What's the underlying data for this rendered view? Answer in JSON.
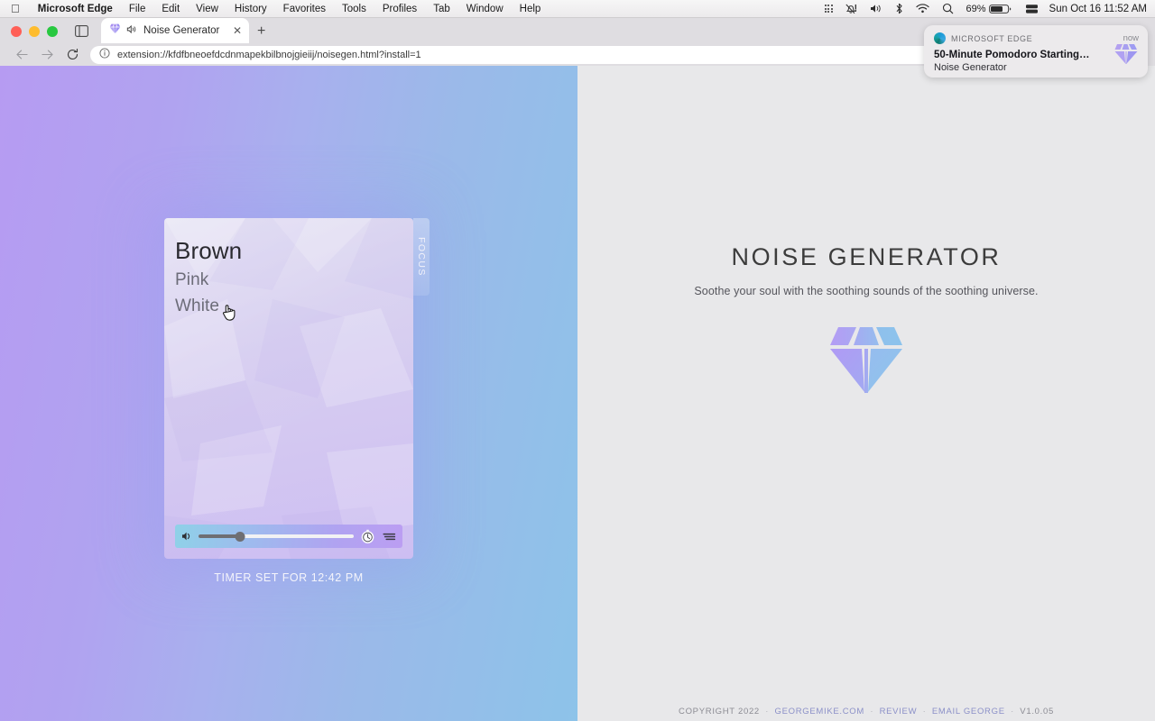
{
  "menubar": {
    "apple_icon": "apple-logo-icon",
    "items": [
      {
        "label": "Microsoft Edge",
        "bold": true
      },
      {
        "label": "File",
        "bold": false
      },
      {
        "label": "Edit",
        "bold": false
      },
      {
        "label": "View",
        "bold": false
      },
      {
        "label": "History",
        "bold": false
      },
      {
        "label": "Favorites",
        "bold": false
      },
      {
        "label": "Tools",
        "bold": false
      },
      {
        "label": "Profiles",
        "bold": false
      },
      {
        "label": "Tab",
        "bold": false
      },
      {
        "label": "Window",
        "bold": false
      },
      {
        "label": "Help",
        "bold": false
      }
    ],
    "status_icons": [
      "control-center-grid-icon",
      "notification-alert-icon",
      "volume-icon",
      "bluetooth-icon",
      "wifi-icon",
      "spotlight-search-icon",
      "battery-icon",
      "display-mirroring-icon"
    ],
    "battery_percent": "69%",
    "clock": "Sun Oct 16  11:52 AM"
  },
  "browser": {
    "window_controls": [
      "close",
      "minimize",
      "maximize"
    ],
    "sidebar_toggle_icon": "sidebar-panel-icon",
    "tab": {
      "favicon": "diamond-gem-favicon",
      "audio_icon": "speaker-playing-icon",
      "title": "Noise Generator",
      "close_icon": "close-icon"
    },
    "new_tab_label": "+",
    "nav": {
      "back_icon": "arrow-left-icon",
      "forward_icon": "arrow-right-icon",
      "reload_icon": "reload-icon"
    },
    "omnibox": {
      "info_icon": "info-circle-icon",
      "url": "extension://kfdfbneoefdcdnmapekbilbnojgieiij/noisegen.html?install=1"
    }
  },
  "notification": {
    "app_icon": "microsoft-edge-icon",
    "app_name": "MICROSOFT EDGE",
    "time": "now",
    "title": "50-Minute Pomodoro Starting…",
    "body": "Noise Generator",
    "thumbnail_icon": "diamond-gem-icon"
  },
  "noise_panel": {
    "background_from": "#b69bf2",
    "background_to": "#8dc3e9",
    "sounds": [
      {
        "label": "Brown",
        "active": true
      },
      {
        "label": "Pink",
        "active": false
      },
      {
        "label": "White",
        "active": false
      }
    ],
    "focus_tab_label": "FOCUS",
    "player": {
      "speaker_icon": "speaker-icon",
      "volume_percent": 27,
      "timer_icon": "stopwatch-icon",
      "menu_icon": "hamburger-menu-icon"
    },
    "timer_status": "TIMER SET FOR 12:42 PM",
    "cursor": "pointing-hand-cursor"
  },
  "content": {
    "title": "NOISE GENERATOR",
    "subtitle": "Soothe your soul with the soothing sounds of the soothing universe.",
    "logo_icon": "diamond-gem-logo",
    "footer": {
      "copyright": "COPYRIGHT 2022",
      "links": [
        "GEORGEMIKE.COM",
        "REVIEW",
        "EMAIL GEORGE"
      ],
      "version": "V1.0.05",
      "separator": "·"
    }
  }
}
